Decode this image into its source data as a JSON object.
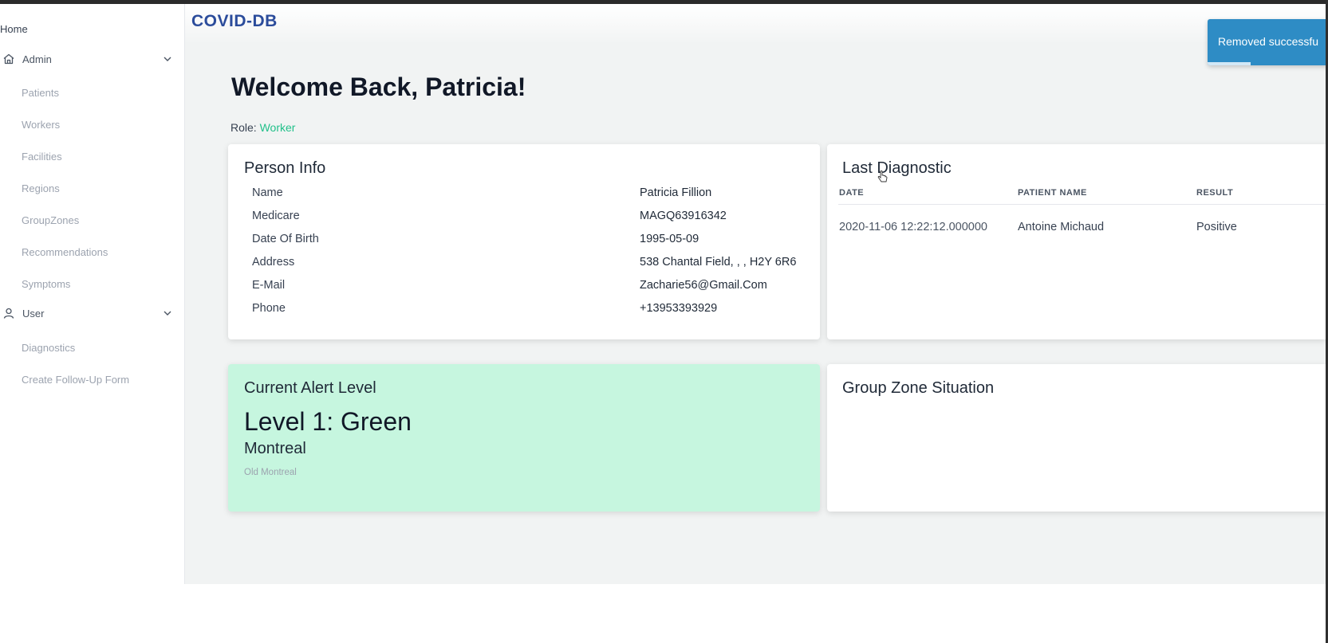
{
  "brand": "COVID-DB",
  "sidebar": {
    "home": "Home",
    "admin": {
      "label": "Admin",
      "items": [
        "Patients",
        "Workers",
        "Facilities",
        "Regions",
        "GroupZones",
        "Recommendations",
        "Symptoms"
      ]
    },
    "user": {
      "label": "User",
      "items": [
        "Diagnostics",
        "Create Follow-Up Form"
      ]
    }
  },
  "welcome": "Welcome Back, Patricia!",
  "role": {
    "label": "Role:",
    "value": "Worker"
  },
  "person_info": {
    "title": "Person Info",
    "rows": [
      {
        "label": "Name",
        "value": "Patricia Fillion"
      },
      {
        "label": "Medicare",
        "value": "MAGQ63916342"
      },
      {
        "label": "Date Of Birth",
        "value": "1995-05-09"
      },
      {
        "label": "Address",
        "value": "538 Chantal Field, , , H2Y 6R6"
      },
      {
        "label": "E-Mail",
        "value": "Zacharie56@Gmail.Com"
      },
      {
        "label": "Phone",
        "value": "+13953393929"
      }
    ]
  },
  "last_diagnostic": {
    "title": "Last Diagnostic",
    "columns": [
      "DATE",
      "PATIENT NAME",
      "RESULT"
    ],
    "row": [
      "2020-11-06 12:22:12.000000",
      "Antoine Michaud",
      "Positive"
    ]
  },
  "alert": {
    "title": "Current Alert Level",
    "level": "Level 1: Green",
    "city": "Montreal",
    "zone": "Old Montreal"
  },
  "group_zone": {
    "title": "Group Zone Situation"
  },
  "toast": {
    "message": "Removed successfu"
  },
  "colors": {
    "brand": "#2b4c9b",
    "role_accent": "#22c08a",
    "alert_bg": "#c6f6df",
    "toast_bg": "#2e8cc5"
  },
  "icons": {
    "admin": "home-icon",
    "user": "user-icon",
    "expand": "chevron-down-icon"
  }
}
